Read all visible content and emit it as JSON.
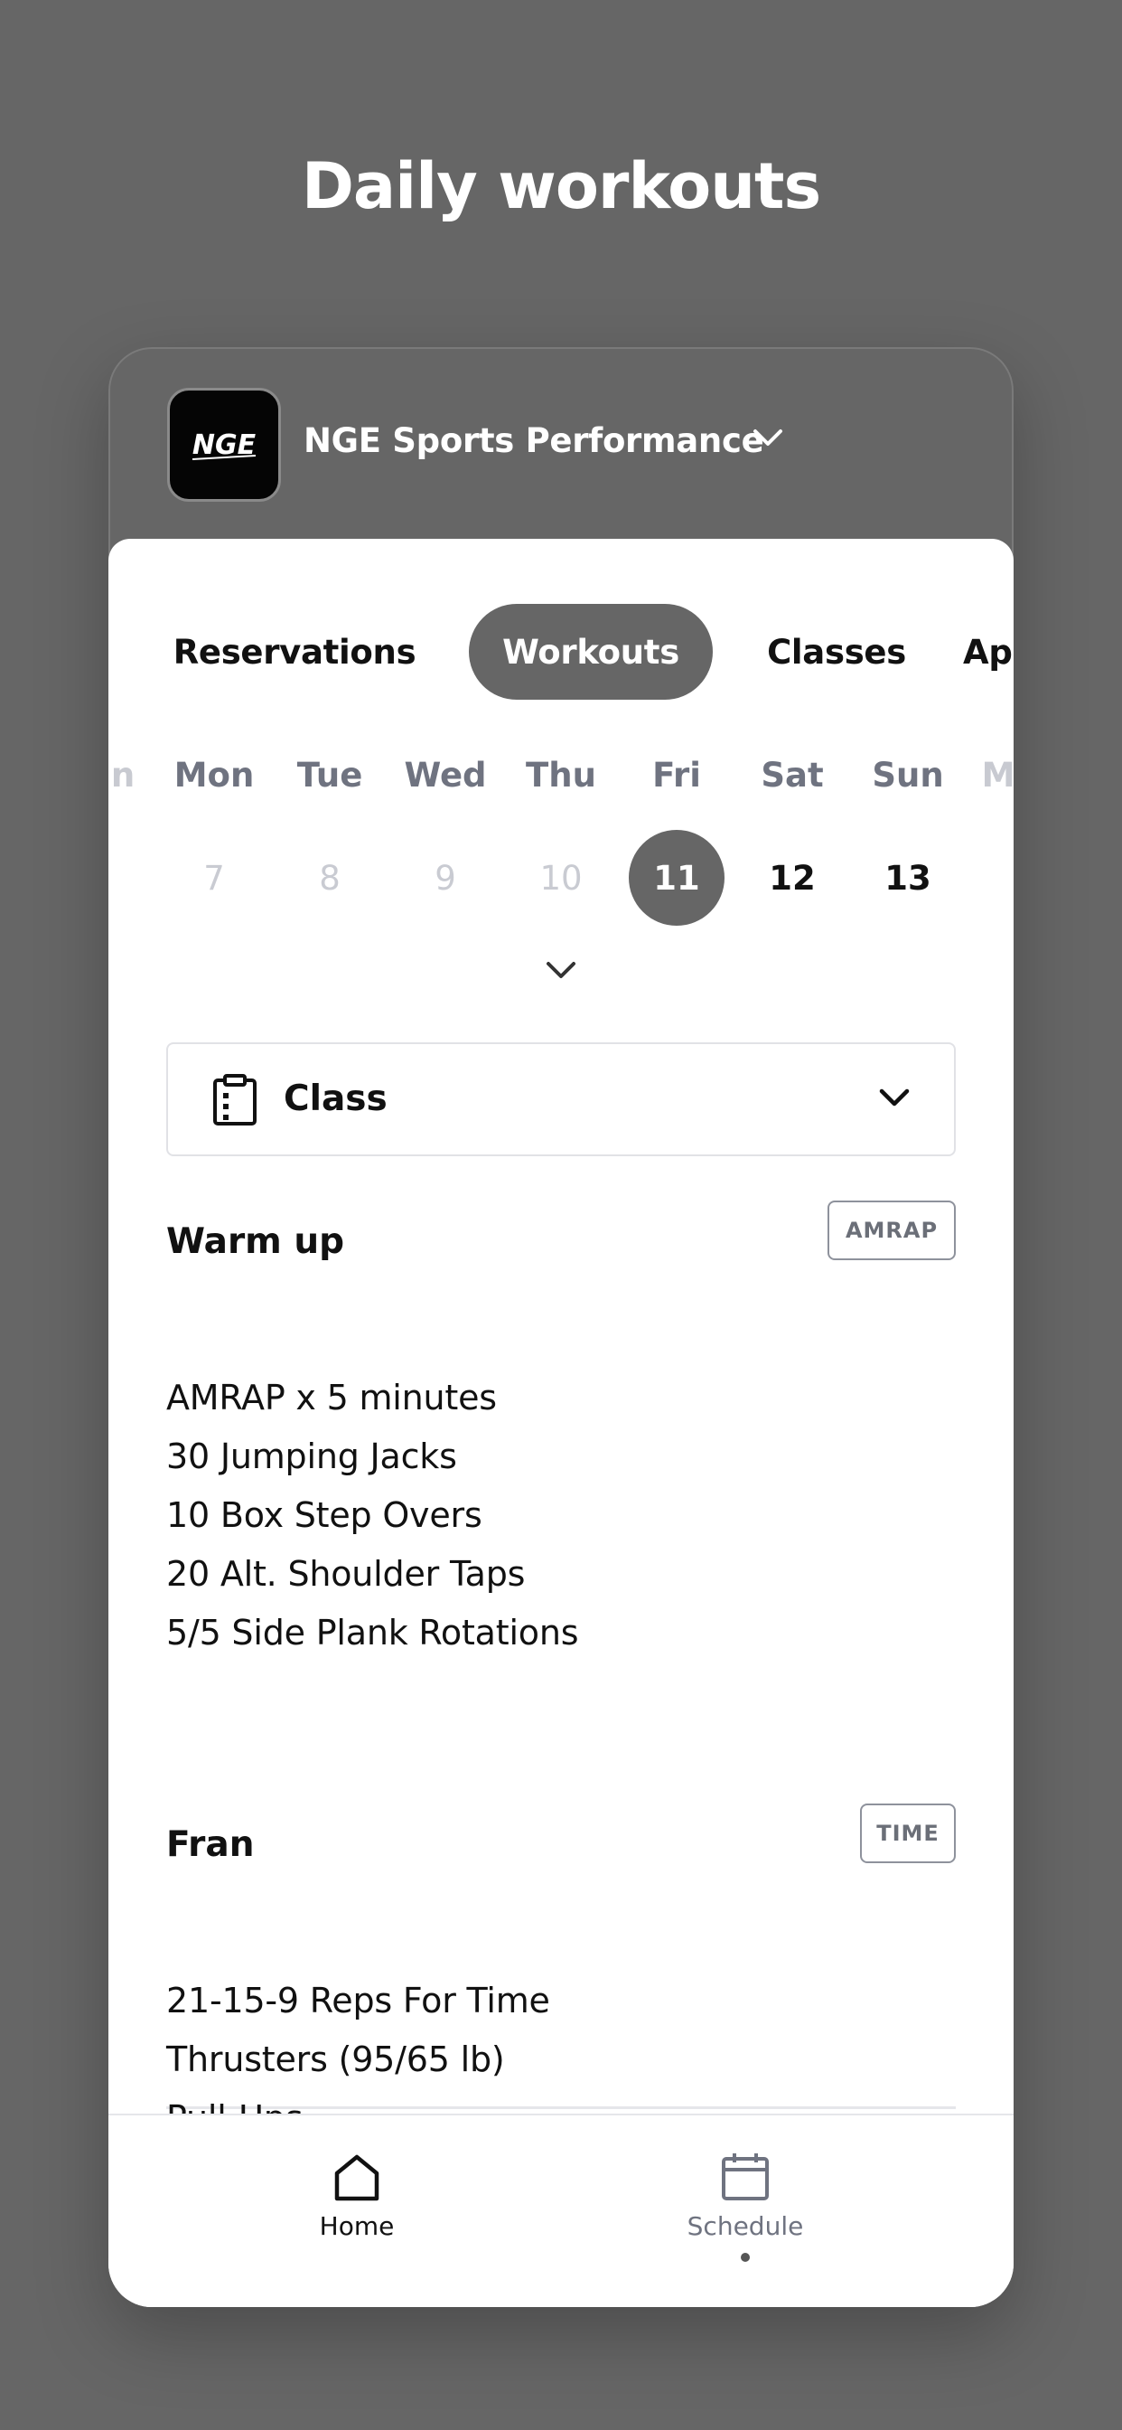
{
  "headline": "Daily workouts",
  "gym": {
    "name": "NGE Sports Performance",
    "logo_text": "NGE"
  },
  "tabs": [
    {
      "label": "Reservations",
      "active": false
    },
    {
      "label": "Workouts",
      "active": true
    },
    {
      "label": "Classes",
      "active": false
    },
    {
      "label": "Ap",
      "active": false
    }
  ],
  "week": {
    "days": [
      "n",
      "Mon",
      "Tue",
      "Wed",
      "Thu",
      "Fri",
      "Sat",
      "Sun",
      "M"
    ],
    "dates": [
      "7",
      "8",
      "9",
      "10",
      "11",
      "12",
      "13"
    ],
    "selected": "11"
  },
  "program_selector": {
    "label": "Class",
    "icon": "clipboard-icon"
  },
  "sections": [
    {
      "title": "Warm up",
      "badge": "AMRAP",
      "lines": [
        "AMRAP x 5 minutes",
        "30 Jumping Jacks",
        "10 Box Step Overs",
        "20 Alt. Shoulder Taps",
        "5/5 Side Plank Rotations"
      ]
    },
    {
      "title": "Fran",
      "badge": "TIME",
      "lines": [
        "21-15-9 Reps For Time",
        "Thrusters (95/65 lb)",
        "Pull-Ups"
      ]
    }
  ],
  "bottom_nav": [
    {
      "label": "Home",
      "icon": "home-icon",
      "active": true
    },
    {
      "label": "Schedule",
      "icon": "calendar-icon",
      "active": false
    }
  ],
  "colors": {
    "background": "#666666",
    "accent": "#666666",
    "text": "#111111",
    "muted": "#6f7380",
    "faded": "#c9cbd2"
  }
}
